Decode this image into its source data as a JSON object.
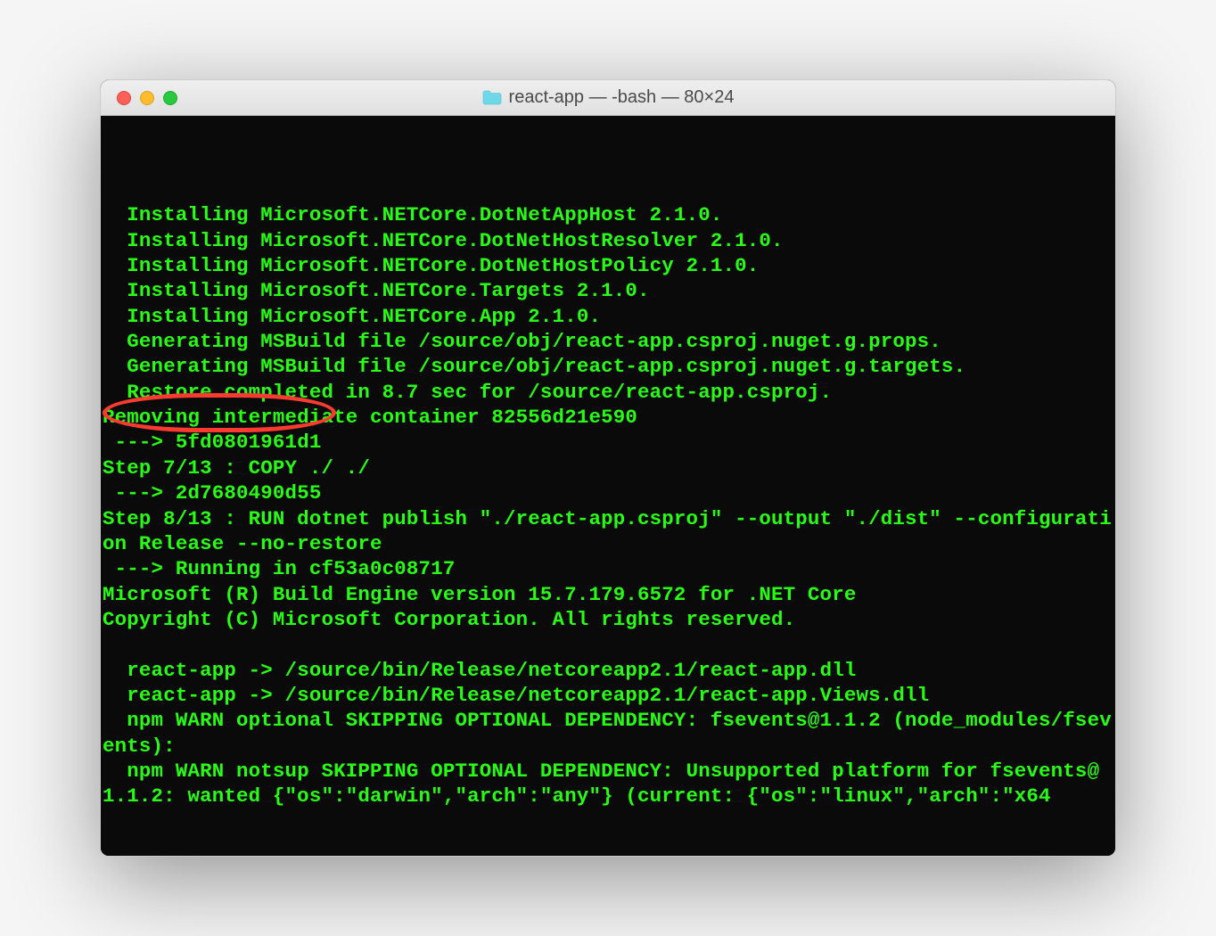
{
  "window": {
    "title": "react-app — -bash — 80×24"
  },
  "terminal": {
    "lines": [
      "  Installing Microsoft.NETCore.DotNetAppHost 2.1.0.",
      "  Installing Microsoft.NETCore.DotNetHostResolver 2.1.0.",
      "  Installing Microsoft.NETCore.DotNetHostPolicy 2.1.0.",
      "  Installing Microsoft.NETCore.Targets 2.1.0.",
      "  Installing Microsoft.NETCore.App 2.1.0.",
      "  Generating MSBuild file /source/obj/react-app.csproj.nuget.g.props.",
      "  Generating MSBuild file /source/obj/react-app.csproj.nuget.g.targets.",
      "  Restore completed in 8.7 sec for /source/react-app.csproj.",
      "Removing intermediate container 82556d21e590",
      " ---> 5fd0801961d1",
      "Step 7/13 : COPY ./ ./",
      " ---> 2d7680490d55",
      "Step 8/13 : RUN dotnet publish \"./react-app.csproj\" --output \"./dist\" --configuration Release --no-restore",
      " ---> Running in cf53a0c08717",
      "Microsoft (R) Build Engine version 15.7.179.6572 for .NET Core",
      "Copyright (C) Microsoft Corporation. All rights reserved.",
      "",
      "  react-app -> /source/bin/Release/netcoreapp2.1/react-app.dll",
      "  react-app -> /source/bin/Release/netcoreapp2.1/react-app.Views.dll",
      "  npm WARN optional SKIPPING OPTIONAL DEPENDENCY: fsevents@1.1.2 (node_modules/fsevents):",
      "  npm WARN notsup SKIPPING OPTIONAL DEPENDENCY: Unsupported platform for fsevents@1.1.2: wanted {\"os\":\"darwin\",\"arch\":\"any\"} (current: {\"os\":\"linux\",\"arch\":\"x64"
    ]
  },
  "annotation": {
    "highlighted_line_index": 11
  }
}
